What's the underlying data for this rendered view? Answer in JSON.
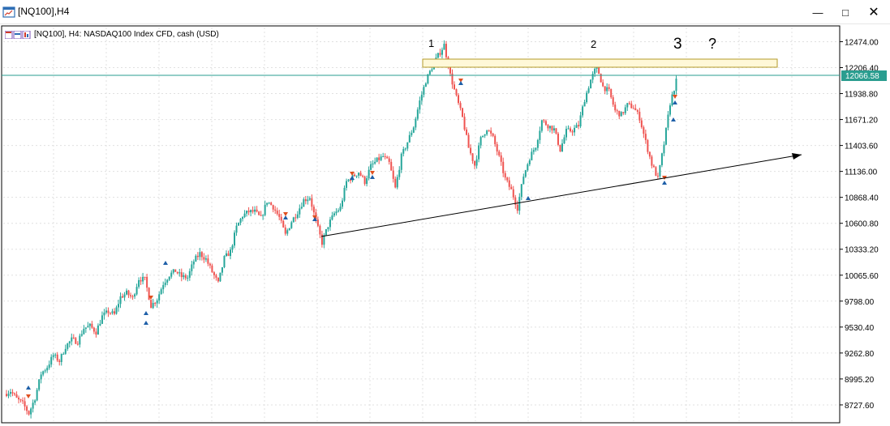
{
  "window": {
    "title": "[NQ100],H4",
    "minimize_icon": "minimize-icon",
    "maximize_icon": "maximize-icon",
    "close_icon": "close-icon"
  },
  "chart": {
    "header_text": "[NQ100], H4:  NASDAQ100 Index CFD, cash (USD)",
    "price_levels": [
      "12474.00",
      "12206.40",
      "11938.80",
      "11671.20",
      "11403.60",
      "11136.00",
      "10868.40",
      "10600.80",
      "10333.20",
      "10065.60",
      "9798.00",
      "9530.40",
      "9262.80",
      "8995.20",
      "8727.60"
    ],
    "current_price": "12066.58",
    "annotations": {
      "peak1": "1",
      "peak2": "2",
      "peak3": "3",
      "question": "?"
    },
    "colors": {
      "bull": "#26a69a",
      "bear": "#ef5350",
      "price_line": "#2a9d8f",
      "zone_fill": "#fff8d8",
      "zone_border": "#b39a2a",
      "grid": "#e0e0e0"
    }
  },
  "chart_data": {
    "type": "candlestick",
    "title": "[NQ100], H4:  NASDAQ100 Index CFD, cash (USD)",
    "ylim": [
      8560,
      12620
    ],
    "y_ticks": [
      12474.0,
      12206.4,
      11938.8,
      11671.2,
      11403.6,
      11136.0,
      10868.4,
      10600.8,
      10333.2,
      10065.6,
      9798.0,
      9530.4,
      9262.8,
      8995.2,
      8727.6
    ],
    "last_price": 12066.58,
    "series": [
      {
        "name": "close",
        "values": [
          8840,
          8870,
          8790,
          8740,
          8640,
          8800,
          9050,
          9120,
          9240,
          9180,
          9330,
          9400,
          9380,
          9520,
          9540,
          9480,
          9640,
          9690,
          9660,
          9840,
          9880,
          9830,
          10030,
          10020,
          9750,
          9820,
          9980,
          10070,
          10110,
          10050,
          10040,
          10210,
          10290,
          10230,
          10100,
          9980,
          10240,
          10310,
          10560,
          10680,
          10720,
          10720,
          10650,
          10830,
          10770,
          10660,
          10480,
          10620,
          10720,
          10840,
          10870,
          10620,
          10400,
          10580,
          10700,
          10760,
          11030,
          11080,
          11130,
          11030,
          11190,
          11250,
          11290,
          11220,
          10960,
          11290,
          11440,
          11600,
          11860,
          12070,
          12210,
          12330,
          12440,
          12130,
          11900,
          11690,
          11380,
          11200,
          11470,
          11580,
          11480,
          11280,
          11060,
          10940,
          10760,
          11090,
          11280,
          11400,
          11660,
          11610,
          11570,
          11360,
          11550,
          11560,
          11610,
          11880,
          12080,
          12220,
          12010,
          11960,
          11760,
          11720,
          11820,
          11800,
          11690,
          11440,
          11210,
          11060,
          11420,
          11840,
          12066.58
        ]
      }
    ],
    "trendline": {
      "from": [
        10380,
        "start"
      ],
      "to": [
        11370,
        "projected"
      ]
    },
    "resistance_zone": [
      12140,
      12220
    ]
  }
}
